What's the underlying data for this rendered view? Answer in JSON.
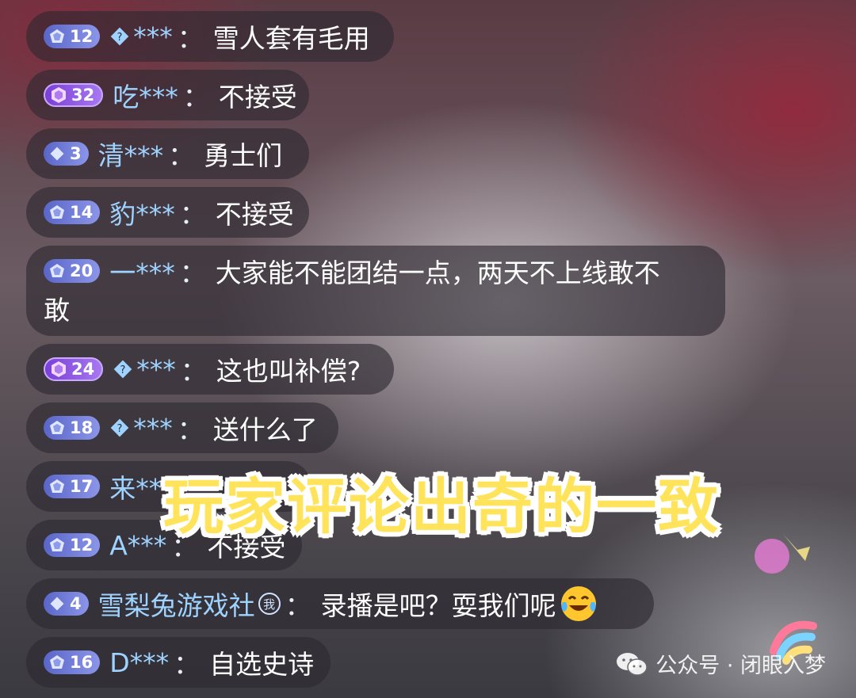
{
  "comments": [
    {
      "level": "12",
      "badge": "blue",
      "name": "***",
      "has_icon": true,
      "colon": "：",
      "message": "雪人套有毛用"
    },
    {
      "level": "32",
      "badge": "purple",
      "name": "吃***",
      "has_icon": false,
      "colon": "：",
      "message": "不接受"
    },
    {
      "level": "3",
      "badge": "blue",
      "name": "清***",
      "has_icon": false,
      "colon": "：",
      "message": "勇士们"
    },
    {
      "level": "14",
      "badge": "blue",
      "name": "豹***",
      "has_icon": false,
      "colon": "：",
      "message": "不接受"
    },
    {
      "level": "20",
      "badge": "blue",
      "name": "一***",
      "has_icon": false,
      "colon": "：",
      "message_line1": "大家能不能团结一点，两天不上线敢不",
      "message_line2": "敢"
    },
    {
      "level": "24",
      "badge": "purple",
      "name": "***",
      "has_icon": true,
      "colon": "：",
      "message": "这也叫补偿?"
    },
    {
      "level": "18",
      "badge": "blue",
      "name": "***",
      "has_icon": true,
      "colon": "：",
      "message": "送什么了"
    },
    {
      "level": "17",
      "badge": "blue",
      "name": "来**",
      "has_icon": false,
      "colon": "",
      "message": ""
    },
    {
      "level": "12",
      "badge": "blue",
      "name": "A***",
      "has_icon": false,
      "colon": "：",
      "message": "不接受"
    },
    {
      "level": "4",
      "badge": "blue",
      "name": "雪梨兔游戏社",
      "me_tag": "我",
      "colon": "：",
      "message": "录播是吧？耍我们呢"
    },
    {
      "level": "16",
      "badge": "blue",
      "name": "D***",
      "has_icon": false,
      "colon": "：",
      "message": "自选史诗"
    }
  ],
  "overlay_title": "玩家评论出奇的一致",
  "watermark": {
    "text": "公众号 · 闭眼入梦",
    "icon": "wechat-icon"
  },
  "colors": {
    "badge_blue": "#6f7ad8",
    "badge_purple": "#8a55e6",
    "name": "#9fd3ff",
    "title": "#ffe35a"
  }
}
